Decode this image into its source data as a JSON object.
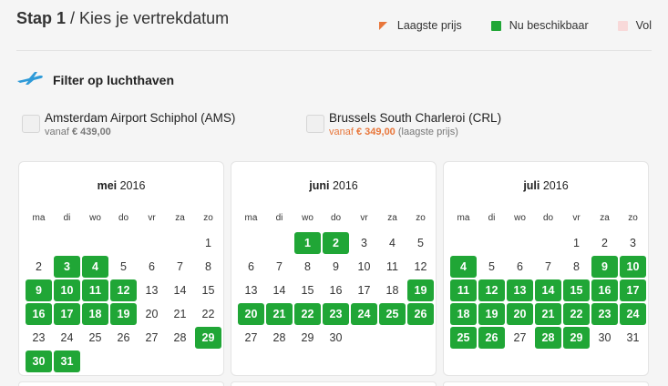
{
  "header": {
    "step_label": "Stap 1",
    "separator": " / ",
    "title": "Kies je vertrekdatum"
  },
  "legend": {
    "lowest": "Laagste prijs",
    "available": "Nu beschikbaar",
    "full": "Vol",
    "colors": {
      "lowest": "#e8763a",
      "available": "#20a636",
      "full": "#f8d9d9"
    }
  },
  "filter": {
    "title": "Filter op luchthaven",
    "icon": "plane-icon"
  },
  "airports": [
    {
      "name": "Amsterdam Airport Schiphol (AMS)",
      "vanaf": "vanaf",
      "price": "€ 439,00",
      "note": ""
    },
    {
      "name": "Brussels South Charleroi (CRL)",
      "vanaf": "vanaf",
      "price": "€ 349,00",
      "note": "(laagste prijs)"
    }
  ],
  "weekdays": [
    "ma",
    "di",
    "wo",
    "do",
    "vr",
    "za",
    "zo"
  ],
  "months": [
    {
      "month": "mei",
      "year": "2016",
      "offset": 6,
      "count": 31,
      "available": [
        3,
        4,
        9,
        10,
        11,
        12,
        16,
        17,
        18,
        19,
        29,
        30,
        31
      ]
    },
    {
      "month": "juni",
      "year": "2016",
      "offset": 2,
      "count": 30,
      "available": [
        1,
        2,
        19,
        20,
        21,
        22,
        23,
        24,
        25,
        26
      ]
    },
    {
      "month": "juli",
      "year": "2016",
      "offset": 4,
      "count": 31,
      "available": [
        4,
        9,
        10,
        11,
        12,
        13,
        14,
        15,
        16,
        17,
        18,
        19,
        20,
        21,
        22,
        23,
        24,
        25,
        26,
        28,
        29
      ]
    }
  ]
}
